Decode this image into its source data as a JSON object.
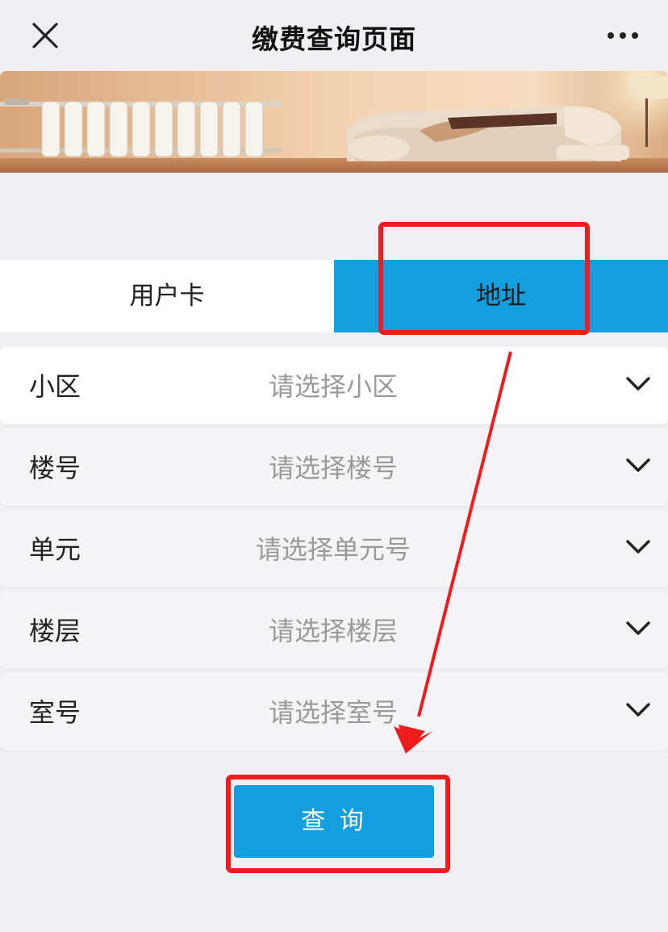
{
  "header": {
    "title": "缴费查询页面",
    "close_icon": "close-icon",
    "more_icon": "more-icon"
  },
  "banner": {
    "image": "living-room-radiator-banner"
  },
  "tabs": [
    {
      "label": "用户卡",
      "selected": false
    },
    {
      "label": "地址",
      "selected": true
    }
  ],
  "form": {
    "rows": [
      {
        "label": "小区",
        "placeholder": "请选择小区"
      },
      {
        "label": "楼号",
        "placeholder": "请选择楼号"
      },
      {
        "label": "单元",
        "placeholder": "请选择单元号"
      },
      {
        "label": "楼层",
        "placeholder": "请选择楼层"
      },
      {
        "label": "室号",
        "placeholder": "请选择室号"
      }
    ],
    "chevron_icon": "chevron-down-icon"
  },
  "query_button": {
    "label": "查 询"
  },
  "colors": {
    "accent": "#139fdf",
    "annotation": "#ee1c1c",
    "background": "#efeff4"
  }
}
